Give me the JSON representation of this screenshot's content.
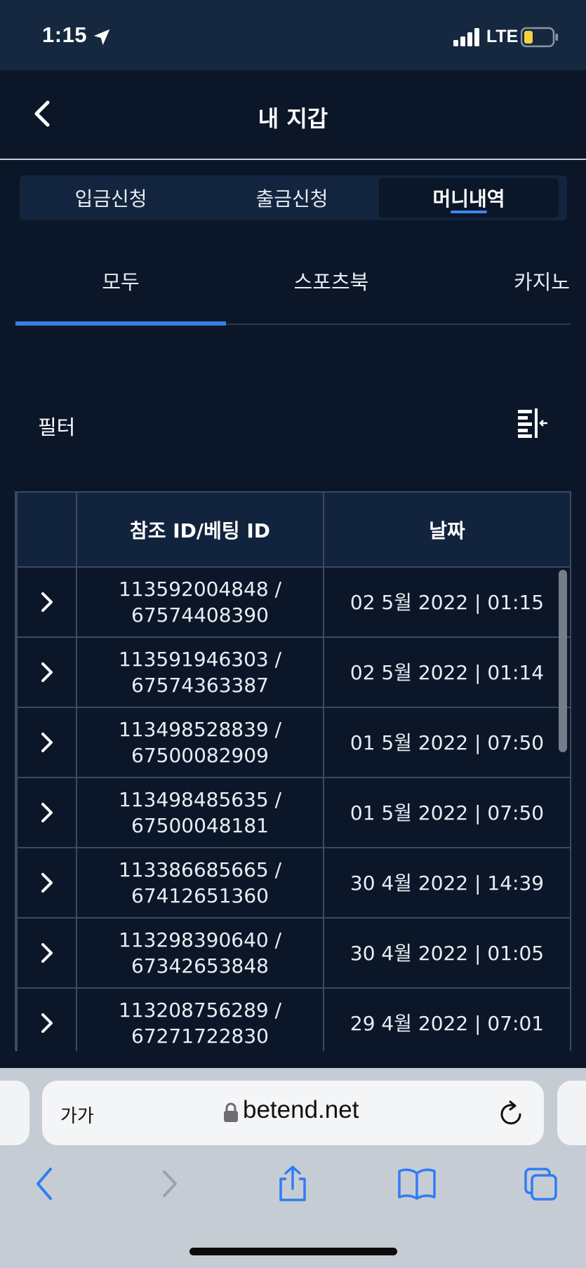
{
  "status_bar": {
    "time": "1:15",
    "network": "LTE",
    "icons": [
      "location-arrow-icon",
      "signal-icon",
      "battery-icon"
    ]
  },
  "header": {
    "title": "내 지갑",
    "back_icon": "chevron-left-icon"
  },
  "segment_tabs": [
    {
      "label": "입금신청",
      "active": false
    },
    {
      "label": "출금신청",
      "active": false
    },
    {
      "label": "머니내역",
      "active": true
    }
  ],
  "sub_tabs": [
    {
      "label": "모두",
      "active": true
    },
    {
      "label": "스포츠북",
      "active": false
    },
    {
      "label": "카지노",
      "active": false
    }
  ],
  "filter": {
    "label": "필터",
    "icon": "filter-collapse-icon"
  },
  "table": {
    "headers": {
      "col1": "",
      "col2": "참조 ID/베팅 ID",
      "col3": "날짜"
    },
    "rows": [
      {
        "ref": "113592004848 /",
        "bet": "67574408390",
        "date": "02 5월 2022 | 01:15"
      },
      {
        "ref": "113591946303 /",
        "bet": "67574363387",
        "date": "02 5월 2022 | 01:14"
      },
      {
        "ref": "113498528839 /",
        "bet": "67500082909",
        "date": "01 5월 2022 | 07:50"
      },
      {
        "ref": "113498485635 /",
        "bet": "67500048181",
        "date": "01 5월 2022 | 07:50"
      },
      {
        "ref": "113386685665 /",
        "bet": "67412651360",
        "date": "30 4월 2022 | 14:39"
      },
      {
        "ref": "113298390640 /",
        "bet": "67342653848",
        "date": "30 4월 2022 | 01:05"
      },
      {
        "ref": "113208756289 /",
        "bet": "67271722830",
        "date": "29 4월 2022 | 07:01"
      }
    ]
  },
  "browser": {
    "text_size_label": "가가",
    "url": "betend.net",
    "icons": [
      "lock-icon",
      "reload-icon",
      "back-icon",
      "forward-icon",
      "share-icon",
      "bookmarks-icon",
      "tabs-icon"
    ]
  },
  "colors": {
    "background": "#0b1628",
    "accent": "#3a7de3",
    "header_bg": "#12233d",
    "border": "#3b4a61"
  }
}
